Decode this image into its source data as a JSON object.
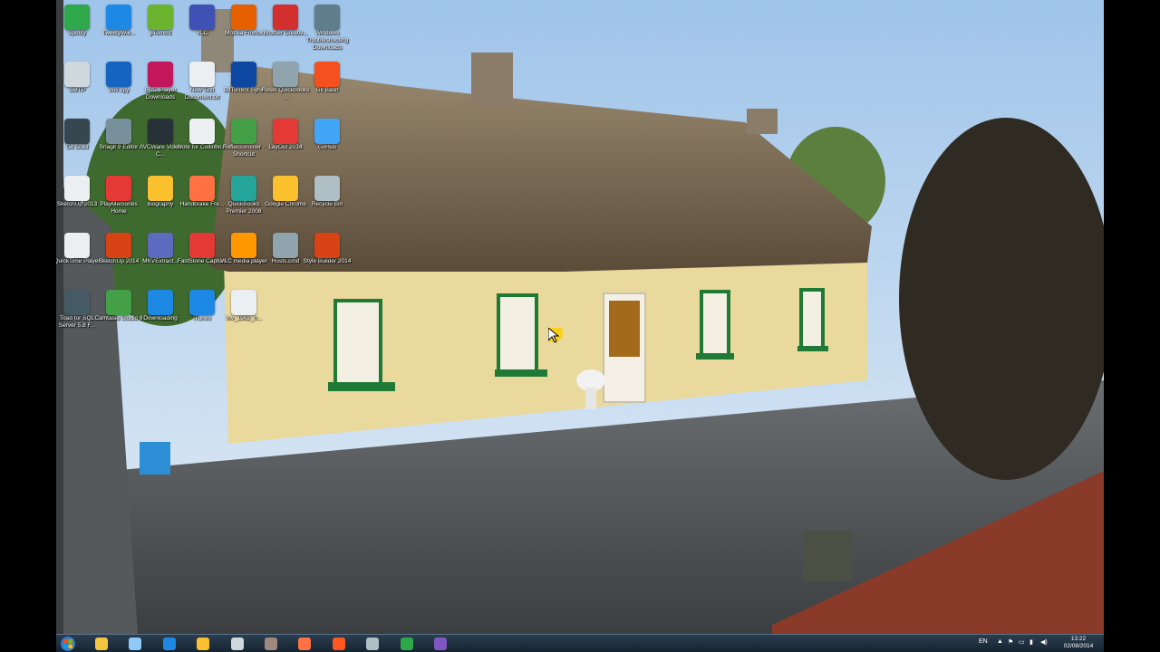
{
  "desktop": {
    "icons": [
      {
        "label": "Spotify",
        "icon": "spotify-icon",
        "color": "#2ea84a"
      },
      {
        "label": "TweetyWik...",
        "icon": "tweety-icon",
        "color": "#1e88e5"
      },
      {
        "label": "µTorrent",
        "icon": "utorrent-icon",
        "color": "#6bb32e"
      },
      {
        "label": "VLC",
        "icon": "media-player-icon",
        "color": "#3f51b5"
      },
      {
        "label": "Mozilla Firefox",
        "icon": "firefox-icon",
        "color": "#e66000"
      },
      {
        "label": "Brother Creativ...",
        "icon": "brother-icon",
        "color": "#d32f2f"
      },
      {
        "label": "Windows Troubleshooting Downloads",
        "icon": "shortcut-icon",
        "color": "#607d8b"
      },
      {
        "label": "SMTP",
        "icon": "mail-icon",
        "color": "#cfd8dc"
      },
      {
        "label": "Wifi spy",
        "icon": "wifi-icon",
        "color": "#1565c0"
      },
      {
        "label": "BBC iPlayer Downloads",
        "icon": "iplayer-icon",
        "color": "#c2185b"
      },
      {
        "label": "New Text Document.txt",
        "icon": "text-file-icon",
        "color": "#eceff1"
      },
      {
        "label": "BitTorrent Sync",
        "icon": "bittorrent-icon",
        "color": "#0d47a1"
      },
      {
        "label": "Reset Quickbooks ...",
        "icon": "settings-icon",
        "color": "#90a4ae"
      },
      {
        "label": "Git Bash",
        "icon": "git-icon",
        "color": "#f4511e"
      },
      {
        "label": "Git Shell",
        "icon": "git-shell-icon",
        "color": "#37474f"
      },
      {
        "label": "Snagit 9 Editor",
        "icon": "snagit-icon",
        "color": "#78909c"
      },
      {
        "label": "AVCWare Video C...",
        "icon": "video-converter-icon",
        "color": "#263238"
      },
      {
        "label": "Note for Collinbo...",
        "icon": "note-icon",
        "color": "#eceff1"
      },
      {
        "label": "Reflectorminer - Shortcut",
        "icon": "reflector-icon",
        "color": "#43a047"
      },
      {
        "label": "LayOut 2014",
        "icon": "layout-icon",
        "color": "#e53935"
      },
      {
        "label": "GitHub",
        "icon": "github-icon",
        "color": "#42a5f5"
      },
      {
        "label": "SketchUp 2013",
        "icon": "file-icon",
        "color": "#eceff1"
      },
      {
        "label": "PlayMemories Home",
        "icon": "playmemories-icon",
        "color": "#e53935"
      },
      {
        "label": "biography",
        "icon": "chrome-icon",
        "color": "#fbc02d"
      },
      {
        "label": "Handbrake Fre...",
        "icon": "handbrake-icon",
        "color": "#ff7043"
      },
      {
        "label": "QuickBooks Premier 2008",
        "icon": "quickbooks-icon",
        "color": "#26a69a"
      },
      {
        "label": "Google Chrome",
        "icon": "chrome-icon",
        "color": "#fbc02d"
      },
      {
        "label": "Recycle Bin",
        "icon": "recycle-bin-icon",
        "color": "#b0bec5"
      },
      {
        "label": "QuickTime Player",
        "icon": "quicktime-icon",
        "color": "#eceff1"
      },
      {
        "label": "SketchUp 2014",
        "icon": "sketchup-icon",
        "color": "#d84315"
      },
      {
        "label": "MKVExtract...",
        "icon": "mkv-icon",
        "color": "#5c6bc0"
      },
      {
        "label": "FastStone Capture",
        "icon": "faststone-icon",
        "color": "#e53935"
      },
      {
        "label": "VLC media player",
        "icon": "vlc-icon",
        "color": "#ff9800"
      },
      {
        "label": "Hosts.cmd",
        "icon": "cmd-icon",
        "color": "#90a4ae"
      },
      {
        "label": "Style Builder 2014",
        "icon": "style-builder-icon",
        "color": "#d84315"
      },
      {
        "label": "Toad for SQL Server 5.8 F...",
        "icon": "toad-icon",
        "color": "#455a64"
      },
      {
        "label": "Camtasia Studio 8",
        "icon": "camtasia-icon",
        "color": "#43a047"
      },
      {
        "label": "Downloading",
        "icon": "download-icon",
        "color": "#1e88e5"
      },
      {
        "label": "iTunes",
        "icon": "itunes-icon",
        "color": "#1e88e5"
      },
      {
        "label": "Inv_1962_fr...",
        "icon": "spreadsheet-icon",
        "color": "#eceff1"
      }
    ]
  },
  "taskbar": {
    "start_icon": "windows-start-icon",
    "pinned": [
      {
        "icon": "file-explorer-icon",
        "color": "#f5c542"
      },
      {
        "icon": "network-icon",
        "color": "#90caf9"
      },
      {
        "icon": "internet-explorer-icon",
        "color": "#1e88e5"
      },
      {
        "icon": "chrome-icon",
        "color": "#fbc02d"
      },
      {
        "icon": "remote-desktop-icon",
        "color": "#cfd8dc"
      },
      {
        "icon": "tools-icon",
        "color": "#a1887f"
      },
      {
        "icon": "editor-icon",
        "color": "#ff7043"
      },
      {
        "icon": "media-app-icon",
        "color": "#ff5722"
      },
      {
        "icon": "settings-gear-icon",
        "color": "#b0bec5"
      },
      {
        "icon": "spotify-icon",
        "color": "#2ea84a"
      },
      {
        "icon": "visual-studio-icon",
        "color": "#7e57c2"
      }
    ],
    "tray": {
      "language": "EN",
      "time": "13:22",
      "date": "02/08/2014"
    }
  }
}
